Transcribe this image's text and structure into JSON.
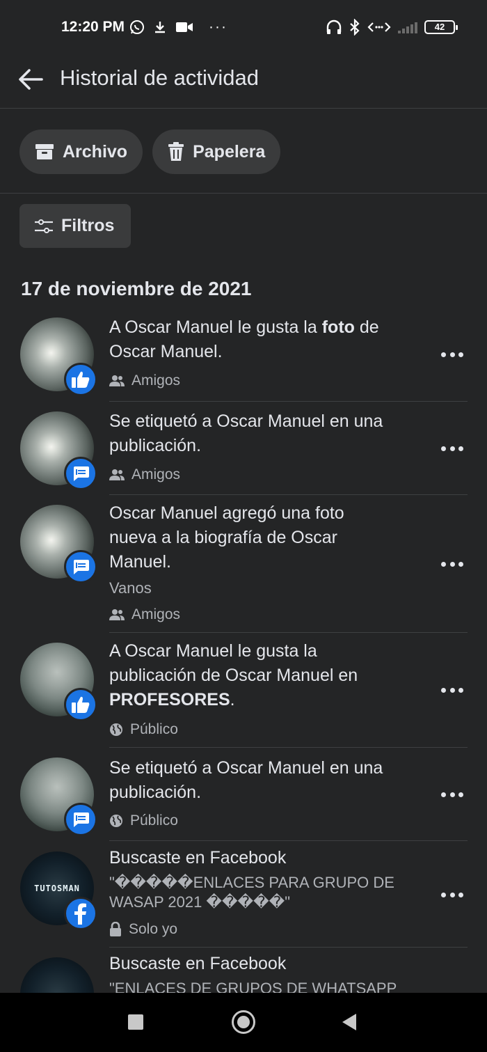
{
  "status_bar": {
    "time": "12:20 PM",
    "dots": "···",
    "battery": "42"
  },
  "header": {
    "title": "Historial de actividad"
  },
  "actions": {
    "archive_label": "Archivo",
    "trash_label": "Papelera",
    "filters_label": "Filtros"
  },
  "date_heading": "17 de noviembre de 2021",
  "activities": [
    {
      "text_a": "A Oscar Manuel le gusta la ",
      "text_bold": "foto",
      "text_b": " de Oscar Manuel.",
      "badge": "like-icon",
      "privacy": "Amigos",
      "privacy_icon": "friends-icon"
    },
    {
      "text": "Se etiquetó a Oscar Manuel en una publicación.",
      "badge": "tag-icon",
      "privacy": "Amigos",
      "privacy_icon": "friends-icon"
    },
    {
      "text": "Oscar Manuel agregó una foto nueva a la biografía de Oscar Manuel.",
      "subtext": "Vanos",
      "badge": "tag-icon",
      "privacy": "Amigos",
      "privacy_icon": "friends-icon"
    },
    {
      "text_a": "A Oscar Manuel le gusta la publicación de Oscar Manuel en ",
      "text_bold": "PROFESORES",
      "text_b": ".",
      "badge": "like-icon",
      "privacy": "Público",
      "privacy_icon": "globe-icon"
    },
    {
      "text": "Se etiquetó a Oscar Manuel en una publicación.",
      "badge": "tag-icon",
      "privacy": "Público",
      "privacy_icon": "globe-icon"
    },
    {
      "text": "Buscaste en Facebook",
      "subtext": "\"�����ENLACES PARA GRUPO DE WASAP 2021 �����\"",
      "avatar_text": "TUTOSMAN",
      "badge": "facebook-icon",
      "privacy": "Solo yo",
      "privacy_icon": "lock-icon"
    },
    {
      "text": "Buscaste en Facebook",
      "subtext": "\"ENLACES DE GRUPOS DE WHATSAPP",
      "badge": "facebook-icon"
    }
  ],
  "colors": {
    "background": "#242526",
    "accent": "#1b74e4",
    "pill": "#3a3b3c"
  }
}
